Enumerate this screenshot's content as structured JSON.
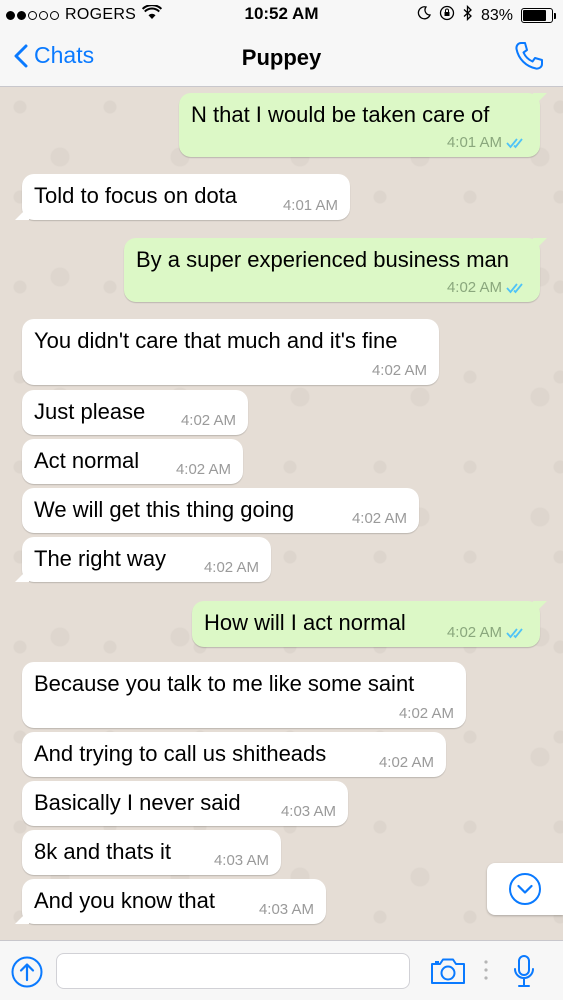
{
  "status_bar": {
    "carrier": "ROGERS",
    "time": "10:52 AM",
    "battery": "83%",
    "battery_level": 0.83,
    "signal_bars_filled": 2,
    "signal_bars_total": 5
  },
  "nav": {
    "back_label": "Chats",
    "title": "Puppey"
  },
  "messages": [
    {
      "dir": "out",
      "text": "N that I would be taken care of",
      "time": "4:01 AM",
      "read": true
    },
    {
      "dir": "in",
      "text": "Told to focus on dota",
      "time": "4:01 AM"
    },
    {
      "dir": "out",
      "text": "By a super experienced business man",
      "time": "4:02 AM",
      "read": true
    },
    {
      "dir": "in",
      "text": "You didn't care that much and it's fine",
      "time": "4:02 AM"
    },
    {
      "dir": "in",
      "text": "Just please",
      "time": "4:02 AM"
    },
    {
      "dir": "in",
      "text": "Act normal",
      "time": "4:02 AM"
    },
    {
      "dir": "in",
      "text": "We will get this thing going",
      "time": "4:02 AM"
    },
    {
      "dir": "in",
      "text": "The right way",
      "time": "4:02 AM"
    },
    {
      "dir": "out",
      "text": "How will I act normal",
      "time": "4:02 AM",
      "read": true
    },
    {
      "dir": "in",
      "text": "Because you talk to me like some saint",
      "time": "4:02 AM"
    },
    {
      "dir": "in",
      "text": "And trying to call us shitheads",
      "time": "4:02 AM"
    },
    {
      "dir": "in",
      "text": "Basically I never said",
      "time": "4:03 AM"
    },
    {
      "dir": "in",
      "text": "8k and thats it",
      "time": "4:03 AM"
    },
    {
      "dir": "in",
      "text": "And you know that",
      "time": "4:03 AM"
    }
  ],
  "input": {
    "value": "",
    "placeholder": ""
  },
  "icons": {
    "back": "chevron-left-icon",
    "call": "phone-icon",
    "attach": "arrow-up-circle-icon",
    "camera": "camera-icon",
    "mic": "microphone-icon",
    "scroll": "chevron-down-circle-icon",
    "read_receipt": "double-check-icon"
  },
  "colors": {
    "accent": "#0a7aff",
    "outgoing_bubble": "#dcf8c6",
    "incoming_bubble": "#ffffff",
    "chat_background": "#e5ddd5",
    "read_check": "#4fc3f7"
  }
}
